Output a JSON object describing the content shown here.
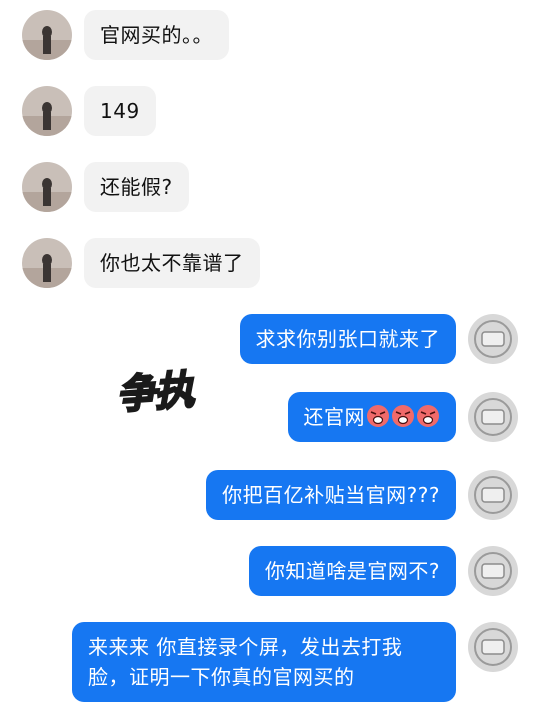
{
  "incoming": [
    {
      "text": "官网买的。。"
    },
    {
      "text": "149"
    },
    {
      "text": "还能假?"
    },
    {
      "text": "你也太不靠谱了"
    }
  ],
  "outgoing": [
    {
      "text": "求求你别张口就来了"
    },
    {
      "text": "还官网",
      "emoji": [
        "angry-face",
        "angry-face",
        "angry-face"
      ]
    },
    {
      "text": "你把百亿补贴当官网???"
    },
    {
      "text": "你知道啥是官网不?"
    },
    {
      "line1": "来来来 你直接录个屏，发出去打我",
      "line2": "脸，证明一下你真的官网买的"
    }
  ],
  "sticker_text": "争执",
  "colors": {
    "bubble_in": "#f2f2f2",
    "bubble_out": "#1677f2",
    "sticker": "#f4f27a"
  }
}
